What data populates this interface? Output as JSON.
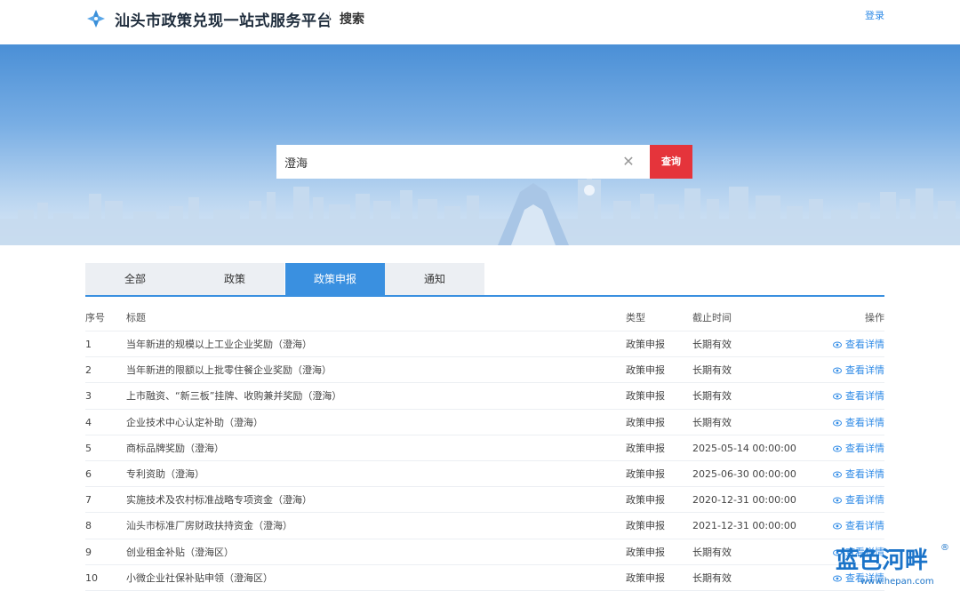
{
  "header": {
    "site_title": "汕头市政策兑现一站式服务平台",
    "page_name": "搜索",
    "login": "登录"
  },
  "search": {
    "value": "澄海",
    "button": "查询",
    "clear_icon": "close-icon"
  },
  "tabs": [
    {
      "label": "全部",
      "active": false
    },
    {
      "label": "政策",
      "active": false
    },
    {
      "label": "政策申报",
      "active": true
    },
    {
      "label": "通知",
      "active": false
    }
  ],
  "table": {
    "headers": {
      "no": "序号",
      "title": "标题",
      "type": "类型",
      "deadline": "截止时间",
      "op": "操作"
    },
    "rows": [
      {
        "no": "1",
        "title": "当年新进的规模以上工业企业奖励（澄海）",
        "type": "政策申报",
        "deadline": "长期有效",
        "op": "查看详情"
      },
      {
        "no": "2",
        "title": "当年新进的限额以上批零住餐企业奖励（澄海）",
        "type": "政策申报",
        "deadline": "长期有效",
        "op": "查看详情"
      },
      {
        "no": "3",
        "title": "上市融资、“新三板”挂牌、收购兼并奖励（澄海）",
        "type": "政策申报",
        "deadline": "长期有效",
        "op": "查看详情"
      },
      {
        "no": "4",
        "title": "企业技术中心认定补助（澄海）",
        "type": "政策申报",
        "deadline": "长期有效",
        "op": "查看详情"
      },
      {
        "no": "5",
        "title": "商标品牌奖励（澄海）",
        "type": "政策申报",
        "deadline": "2025-05-14 00:00:00",
        "op": "查看详情"
      },
      {
        "no": "6",
        "title": "专利资助（澄海）",
        "type": "政策申报",
        "deadline": "2025-06-30 00:00:00",
        "op": "查看详情"
      },
      {
        "no": "7",
        "title": "实施技术及农村标准战略专项资金（澄海）",
        "type": "政策申报",
        "deadline": "2020-12-31 00:00:00",
        "op": "查看详情"
      },
      {
        "no": "8",
        "title": "汕头市标准厂房财政扶持资金（澄海）",
        "type": "政策申报",
        "deadline": "2021-12-31 00:00:00",
        "op": "查看详情"
      },
      {
        "no": "9",
        "title": "创业租金补贴（澄海区）",
        "type": "政策申报",
        "deadline": "长期有效",
        "op": "查看详情"
      },
      {
        "no": "10",
        "title": "小微企业社保补贴申领（澄海区）",
        "type": "政策申报",
        "deadline": "长期有效",
        "op": "查看详情"
      }
    ]
  },
  "watermark": {
    "brand": "蓝色河畔",
    "url": "www.hepan.com",
    "mark": "®"
  },
  "colors": {
    "accent": "#3a90e0",
    "search_button": "#e5343b",
    "link": "#2e8ae6",
    "watermark": "#1a73c8"
  }
}
